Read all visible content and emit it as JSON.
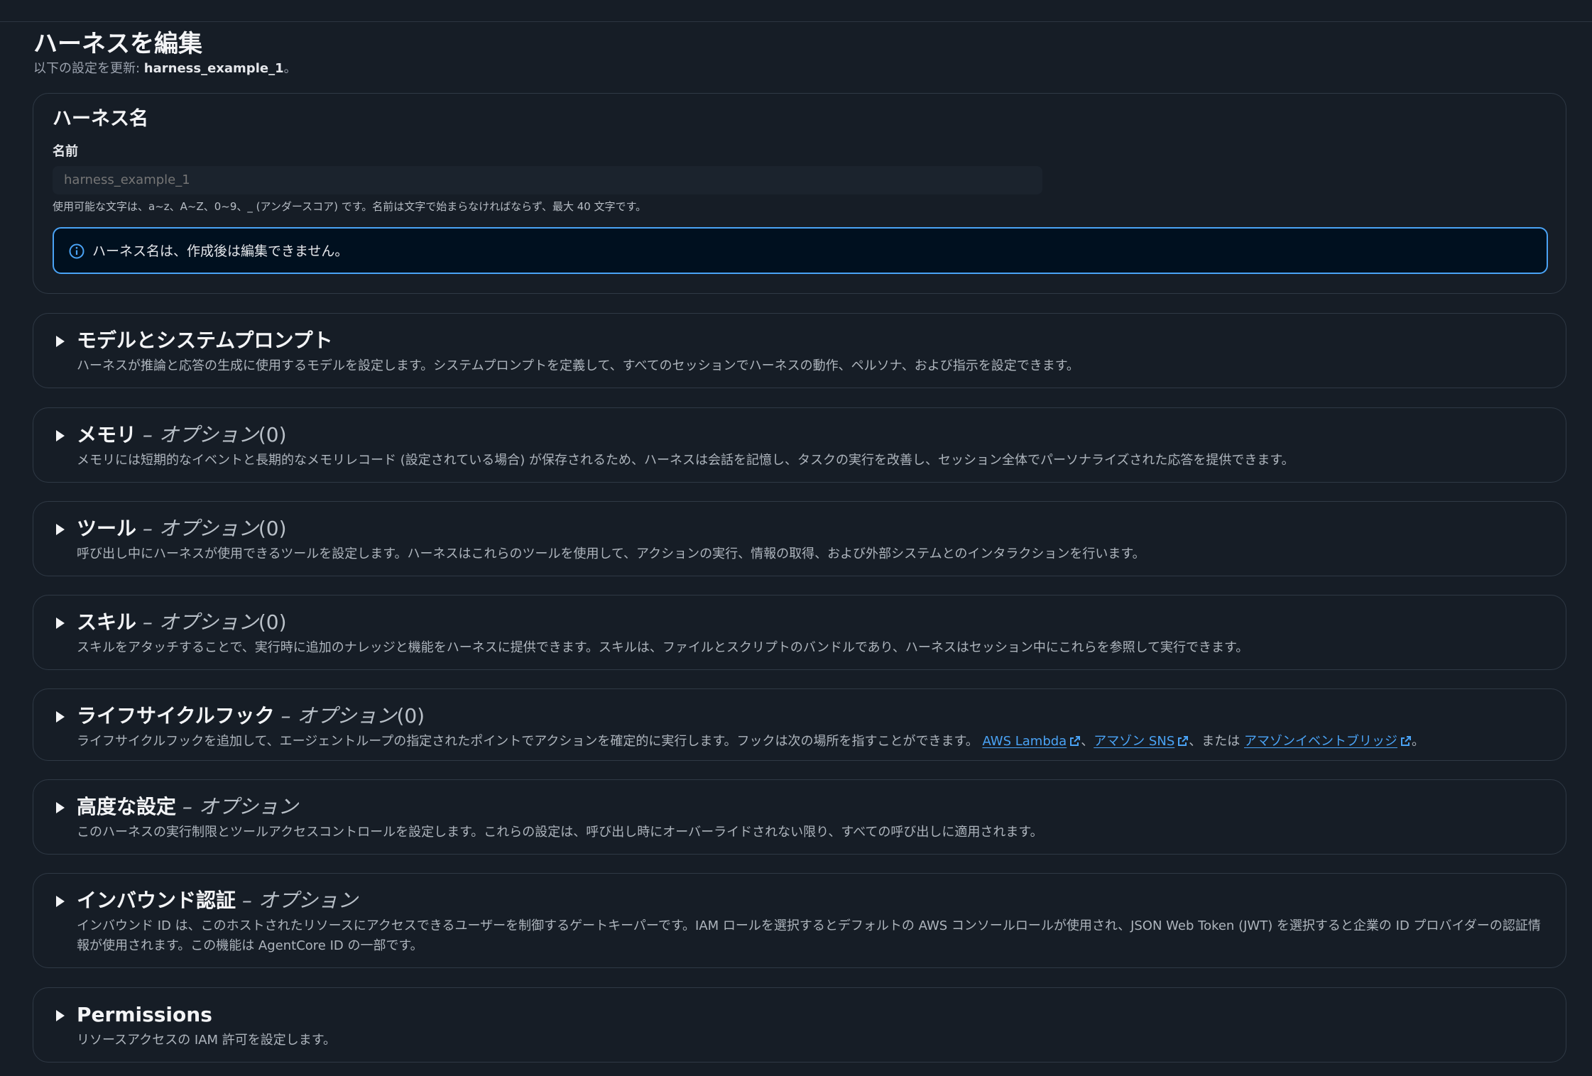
{
  "page": {
    "title": "ハーネスを編集",
    "subtitle_prefix": "以下の設定を更新: ",
    "subtitle_name": "harness_example_1",
    "subtitle_suffix": "。"
  },
  "name_section": {
    "heading": "ハーネス名",
    "field_label": "名前",
    "input_placeholder": "harness_example_1",
    "hint": "使用可能な文字は、a~z、A~Z、0~9、_ (アンダースコア) です。名前は文字で始まらなければならず、最大 40 文字です。",
    "info_alert": "ハーネス名は、作成後は編集できません。"
  },
  "sections": [
    {
      "title": "モデルとシステムプロンプト",
      "description": "ハーネスが推論と応答の生成に使用するモデルを設定します。システムプロンプトを定義して、すべてのセッションでハーネスの動作、ペルソナ、および指示を設定できます。"
    },
    {
      "title": "メモリ",
      "optional": "オプション",
      "count": "(0)",
      "description": "メモリには短期的なイベントと長期的なメモリレコード (設定されている場合) が保存されるため、ハーネスは会話を記憶し、タスクの実行を改善し、セッション全体でパーソナライズされた応答を提供できます。"
    },
    {
      "title": "ツール",
      "optional": "オプション",
      "count": "(0)",
      "description": "呼び出し中にハーネスが使用できるツールを設定します。ハーネスはこれらのツールを使用して、アクションの実行、情報の取得、および外部システムとのインタラクションを行います。"
    },
    {
      "title": "スキル",
      "optional": "オプション",
      "count": "(0)",
      "description": "スキルをアタッチすることで、実行時に追加のナレッジと機能をハーネスに提供できます。スキルは、ファイルとスクリプトのバンドルであり、ハーネスはセッション中にこれらを参照して実行できます。"
    },
    {
      "title": "ライフサイクルフック",
      "optional": "オプション",
      "count": "(0)",
      "description": "ライフサイクルフックを追加して、エージェントループの指定されたポイントでアクションを確定的に実行します。フックは次の場所を指すことができます。",
      "links": [
        "AWS Lambda",
        "アマゾン SNS",
        "アマゾンイベントブリッジ"
      ],
      "sep1": "、",
      "sep2": "、または ",
      "end": "。"
    },
    {
      "title": "高度な設定",
      "optional": "オプション",
      "description": "このハーネスの実行制限とツールアクセスコントロールを設定します。これらの設定は、呼び出し時にオーバーライドされない限り、すべての呼び出しに適用されます。"
    },
    {
      "title": "インバウンド認証",
      "optional": "オプション",
      "description": "インバウンド ID は、このホストされたリソースにアクセスできるユーザーを制御するゲートキーパーです。IAM ロールを選択するとデフォルトの AWS コンソールロールが使用され、JSON Web Token (JWT) を選択すると企業の ID プロバイダーの認証情報が使用されます。この機能は AgentCore ID の一部です。"
    },
    {
      "title": "Permissions",
      "description": "リソースアクセスの IAM 許可を設定します。"
    }
  ],
  "dash": " – ",
  "colors": {
    "background": "#161d26",
    "card_border": "#2f3945",
    "link": "#4aa3f5",
    "alert_bg": "#00101f"
  }
}
